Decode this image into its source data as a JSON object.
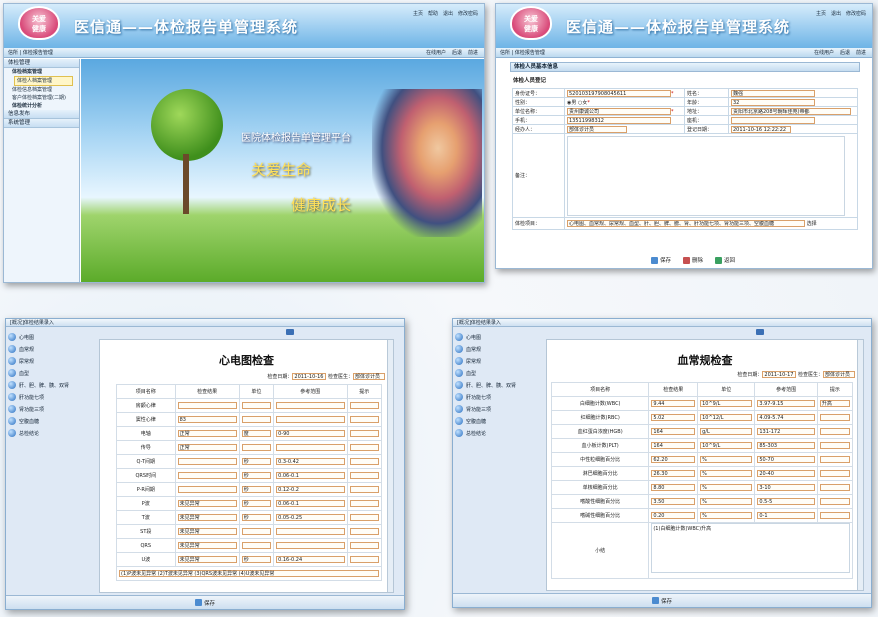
{
  "app": {
    "logo_line1": "关爱",
    "logo_line2": "健康",
    "title": "医信通——体检报告单管理系统",
    "top_links": [
      "主页",
      "帮助",
      "退出",
      "修改密码"
    ],
    "top_links_tr": [
      "主页",
      "退出",
      "修改密码"
    ]
  },
  "panel1": {
    "bar_left": "信所 | 体检报告管理",
    "bar_tools": [
      "在线用户",
      "后退",
      "前进"
    ],
    "sidebar": [
      {
        "label": "体检管理",
        "type": "sec"
      },
      {
        "label": "体检档案管理",
        "type": "bold"
      },
      {
        "label": "体检人档案管理",
        "type": "active"
      },
      {
        "label": "体检信息档案管理",
        "type": "sub"
      },
      {
        "label": "客户体检档案管理(二期)",
        "type": "sub"
      },
      {
        "label": "体检统计分析",
        "type": "bold"
      },
      {
        "label": "信息发布",
        "type": "sec"
      },
      {
        "label": "系统管理",
        "type": "sec"
      }
    ],
    "banner_line1": "医院体检报告单管理平台",
    "banner_line2": "关爱生命",
    "banner_line3": "健康成长"
  },
  "panel2": {
    "bar_left": "信所 | 体检报告管理",
    "bar_tools": [
      "在线用户",
      "后退",
      "前进"
    ],
    "form_title": "体检人员基本信息",
    "section": "体检人员登记",
    "rows": [
      [
        "身份证号：",
        "520103197908045611",
        "姓名：",
        "魏强"
      ],
      [
        "性别：",
        "男",
        "年龄：",
        "32"
      ],
      [
        "单位名称：",
        "贵州康诚公司",
        "地址：",
        "贵阳市北京路208号朝晖佳苑(帝都"
      ],
      [
        "手机：",
        "13511998312",
        "座机：",
        ""
      ],
      [
        "经办人：",
        "部体诊计员",
        "登记日期：",
        "2011-10-16 12:22:22"
      ]
    ],
    "gender_options": [
      "男",
      "女"
    ],
    "remark_label": "备注：",
    "items_label": "体检项目：",
    "items_value": "心电图、血常规、尿常规、血型、肝、胆、脾、膀、肾、肝功能七项、肾功能三项、空腹血糖",
    "items_select": "选择",
    "buttons": [
      "保存",
      "删除",
      "返回"
    ]
  },
  "panel3": {
    "window_title": "[概况]体检结果录入",
    "nav": [
      "心电图",
      "血常规",
      "尿常规",
      "血型",
      "肝、胆、脾、胰、双肾",
      "肝功能七项",
      "肾功能三项",
      "空腹血糖",
      "总检结论"
    ],
    "doc_title": "心电图检查",
    "date_label": "检查日期：",
    "date_value": "2011-10-16",
    "doctor_label": "检查医生：",
    "doctor_value": "部体诊计员",
    "headers": [
      "项目名称",
      "检查结果",
      "单位",
      "参考范围",
      "提示"
    ],
    "rows": [
      [
        "房颤心律",
        "",
        "",
        "",
        ""
      ],
      [
        "窦性心律",
        "83",
        "",
        "",
        ""
      ],
      [
        "电轴",
        "正常",
        "度",
        "0-90",
        ""
      ],
      [
        "传导",
        "正常",
        "",
        "",
        ""
      ],
      [
        "Q-T间期",
        "",
        "秒",
        "0.3-0.42",
        ""
      ],
      [
        "QRS时间",
        "",
        "秒",
        "0.06-0.1",
        ""
      ],
      [
        "P-R间期",
        "",
        "秒",
        "0.12-0.2",
        ""
      ],
      [
        "P波",
        "未见异常",
        "秒",
        "0.06-0.1",
        ""
      ],
      [
        "T波",
        "未见异常",
        "秒",
        "0.05-0.25",
        ""
      ],
      [
        "ST段",
        "未见异常",
        "",
        "",
        ""
      ],
      [
        "QRS",
        "未见异常",
        "",
        "",
        ""
      ],
      [
        "U波",
        "未见异常",
        "秒",
        "0.16-0.24",
        ""
      ]
    ],
    "summary": "(1)P波未见异常 (2)T波未见异常 (3)QRS波未见异常 (4)U波未见异常",
    "save": "保存"
  },
  "panel4": {
    "window_title": "[概况]体检结果录入",
    "nav": [
      "心电图",
      "血常规",
      "尿常规",
      "血型",
      "肝、胆、脾、胰、双肾",
      "肝功能七项",
      "肾功能三项",
      "空腹血糖",
      "总检结论"
    ],
    "doc_title": "血常规检查",
    "date_label": "检查日期：",
    "date_value": "2011-10-17",
    "doctor_label": "检查医生：",
    "doctor_value": "部体诊计员",
    "headers": [
      "项目名称",
      "检查结果",
      "单位",
      "参考范围",
      "提示"
    ],
    "rows": [
      [
        "白细胞计数(WBC)",
        "9.44",
        "10^9/L",
        "3.97-9.15",
        "升高"
      ],
      [
        "红细胞计数(RBC)",
        "5.02",
        "10^12/L",
        "4.09-5.74",
        ""
      ],
      [
        "血红蛋白浓度(HGB)",
        "164",
        "g/L",
        "131-172",
        ""
      ],
      [
        "血小板计数(PLT)",
        "164",
        "10^9/L",
        "85-303",
        ""
      ],
      [
        "中性粒细胞百分比",
        "62.20",
        "%",
        "50-70",
        ""
      ],
      [
        "淋巴细胞百分比",
        "26.30",
        "%",
        "20-40",
        ""
      ],
      [
        "单核细胞百分比",
        "8.80",
        "%",
        "3-10",
        ""
      ],
      [
        "嗜酸性细胞百分比",
        "3.50",
        "%",
        "0.5-5",
        ""
      ],
      [
        "嗜碱性细胞百分比",
        "0.20",
        "%",
        "0-1",
        ""
      ]
    ],
    "summary_label": "小结",
    "summary": "(1)白细胞计数(WBC)升高",
    "save": "保存"
  }
}
